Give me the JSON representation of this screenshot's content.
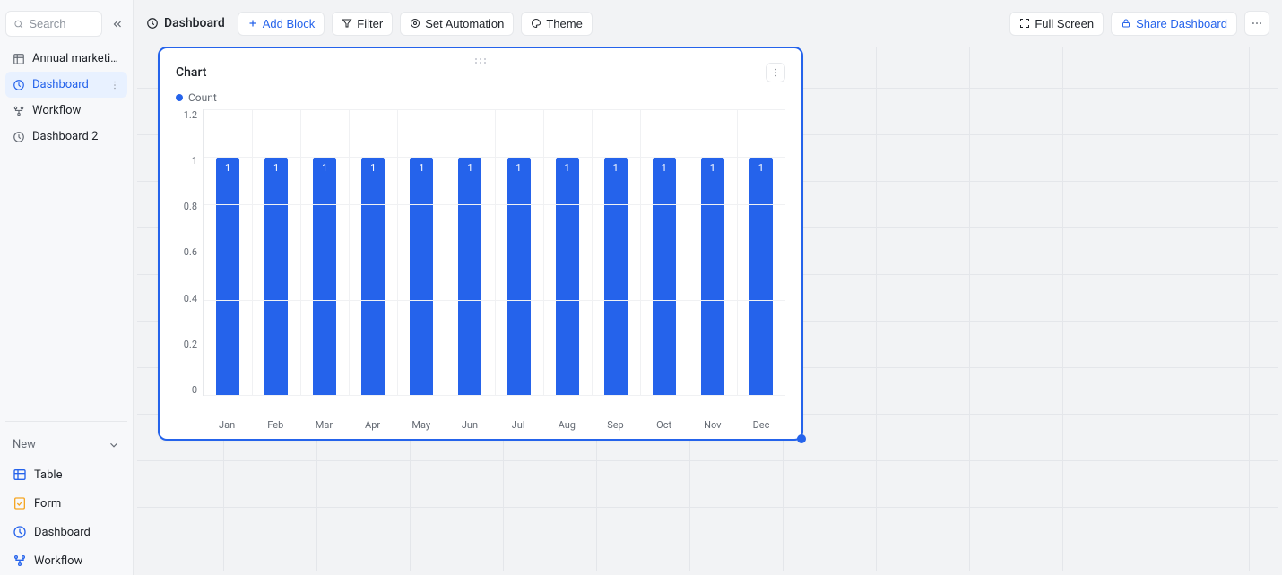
{
  "search": {
    "placeholder": "Search"
  },
  "sidebar": {
    "items": [
      {
        "label": "Annual marketing..."
      },
      {
        "label": "Dashboard"
      },
      {
        "label": "Workflow"
      },
      {
        "label": "Dashboard 2"
      }
    ],
    "new_label": "New",
    "new_items": [
      {
        "label": "Table"
      },
      {
        "label": "Form"
      },
      {
        "label": "Dashboard"
      },
      {
        "label": "Workflow"
      }
    ]
  },
  "topbar": {
    "title": "Dashboard",
    "add_block": "Add Block",
    "filter": "Filter",
    "set_automation": "Set Automation",
    "theme": "Theme",
    "full_screen": "Full Screen",
    "share": "Share Dashboard"
  },
  "card": {
    "title": "Chart",
    "legend": "Count"
  },
  "chart_data": {
    "type": "bar",
    "categories": [
      "Jan",
      "Feb",
      "Mar",
      "Apr",
      "May",
      "Jun",
      "Jul",
      "Aug",
      "Sep",
      "Oct",
      "Nov",
      "Dec"
    ],
    "values": [
      1,
      1,
      1,
      1,
      1,
      1,
      1,
      1,
      1,
      1,
      1,
      1
    ],
    "title": "Chart",
    "xlabel": "",
    "ylabel": "",
    "ylim": [
      0,
      1.2
    ],
    "y_ticks": [
      "1.2",
      "1",
      "0.8",
      "0.6",
      "0.4",
      "0.2",
      "0"
    ],
    "series_name": "Count"
  }
}
